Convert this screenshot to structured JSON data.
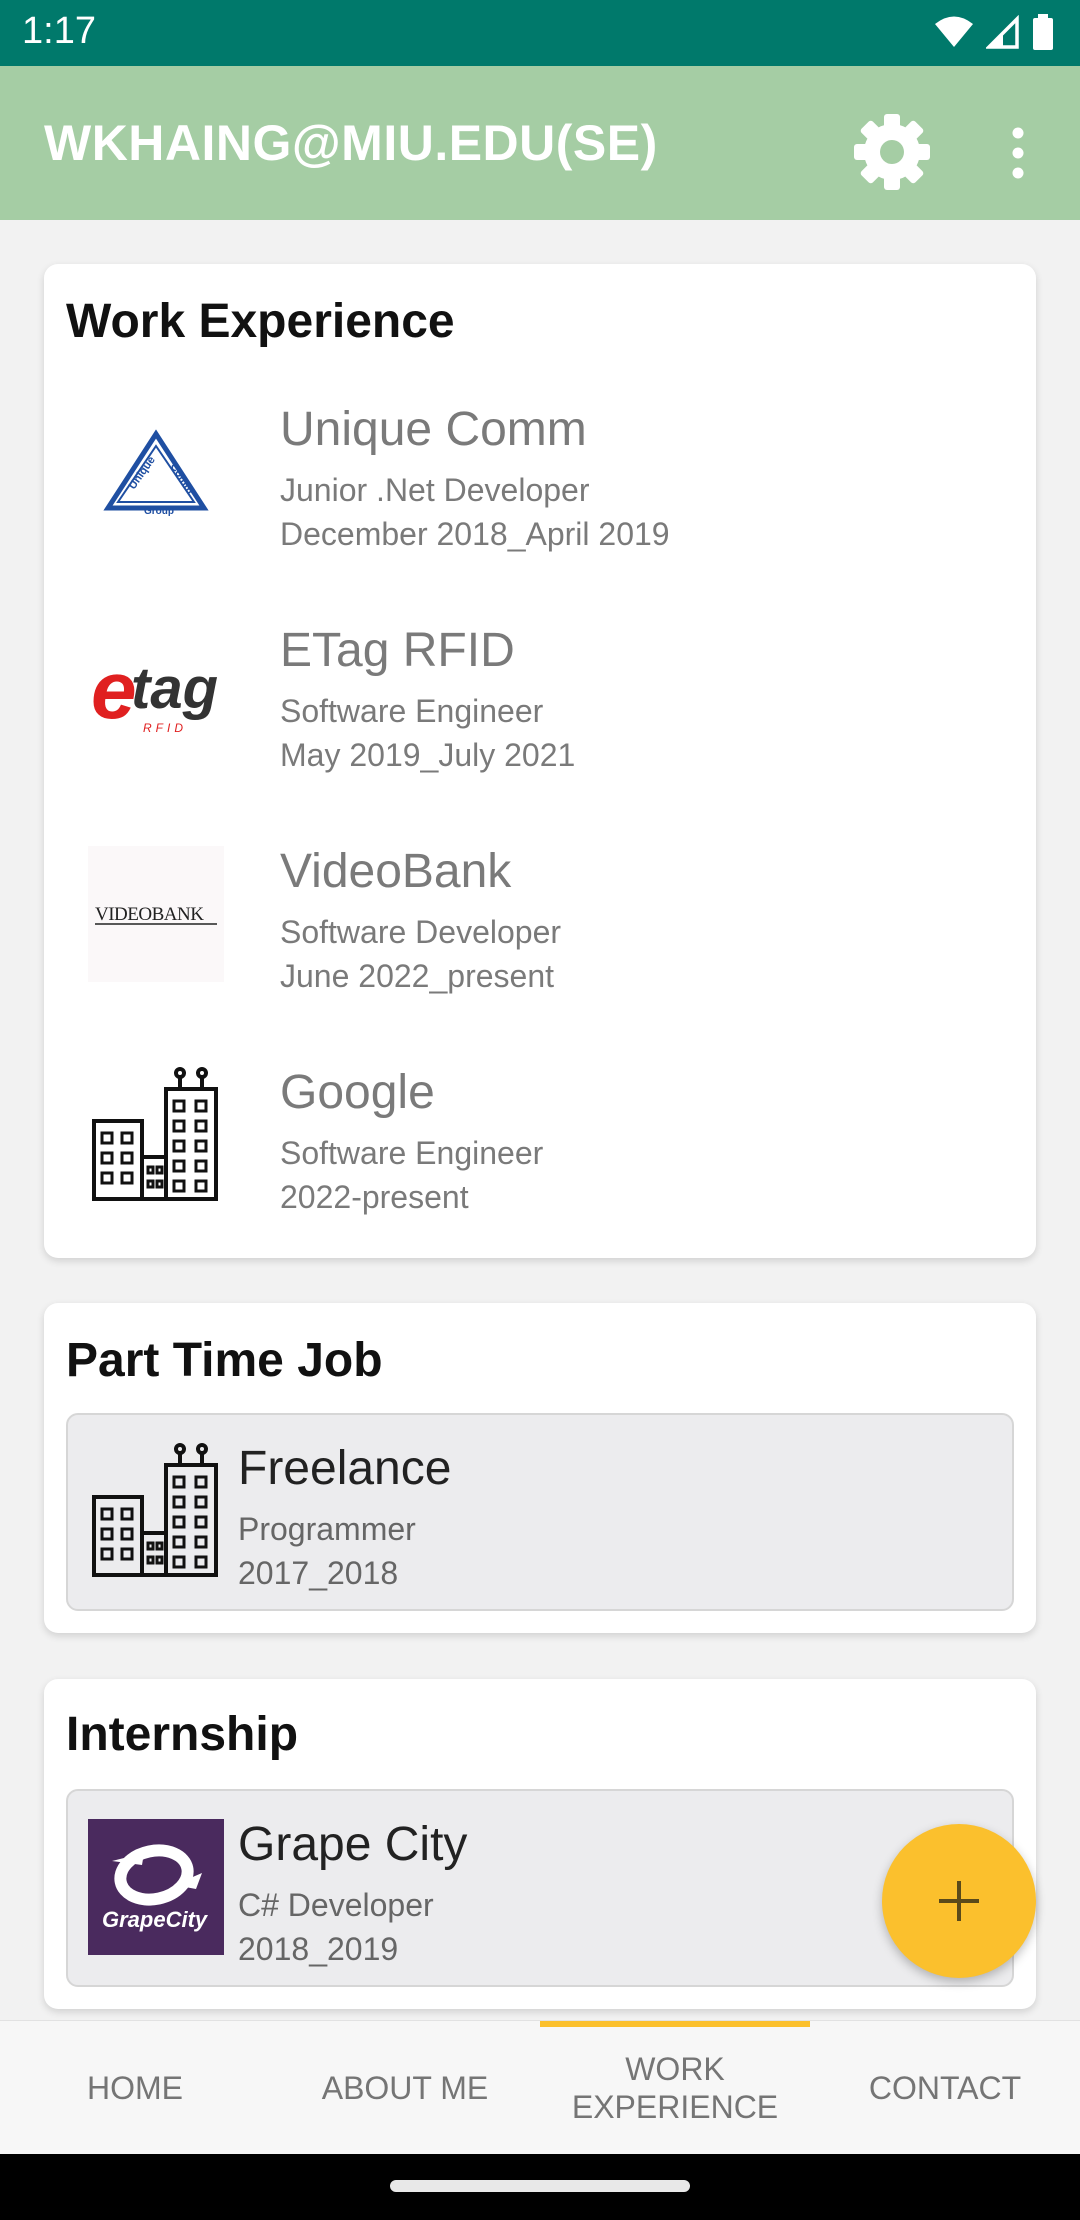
{
  "status_bar": {
    "time": "1:17"
  },
  "app_bar": {
    "title": "WKHAING@MIU.EDU(SE)"
  },
  "work_experience": {
    "title": "Work Experience",
    "items": [
      {
        "company": "Unique Comm",
        "role": "Junior .Net Developer",
        "period": "December 2018_April 2019",
        "logo": "unique-comm-logo",
        "logo_text": [
          "Unique",
          "Comm",
          "Group"
        ]
      },
      {
        "company": "ETag RFID",
        "role": "Software Engineer",
        "period": "May 2019_July 2021",
        "logo": "etag-logo",
        "logo_text": [
          "e",
          "tag",
          "RFID"
        ]
      },
      {
        "company": "VideoBank",
        "role": "Software Developer",
        "period": "June 2022_present",
        "logo": "videobank-logo",
        "logo_text": "VIDEOBANK"
      },
      {
        "company": "Google",
        "role": "Software Engineer",
        "period": "2022-present",
        "logo": "building-icon"
      }
    ]
  },
  "part_time": {
    "title": "Part Time Job",
    "items": [
      {
        "company": "Freelance",
        "role": "Programmer",
        "period": "2017_2018",
        "logo": "building-icon"
      }
    ]
  },
  "internship": {
    "title": "Internship",
    "items": [
      {
        "company": "Grape City",
        "role": "C# Developer",
        "period": "2018_2019",
        "logo": "grapecity-logo",
        "logo_text": "GrapeCity"
      }
    ]
  },
  "bottom_nav": {
    "tabs": [
      {
        "label": "HOME"
      },
      {
        "label": "ABOUT ME"
      },
      {
        "label": "WORK EXPERIENCE",
        "line1": "WORK",
        "line2": "EXPERIENCE",
        "active": true
      },
      {
        "label": "CONTACT"
      }
    ]
  },
  "colors": {
    "status_bar": "#00796b",
    "app_bar": "#a5cda4",
    "accent": "#fbc02d"
  },
  "icons": {
    "settings": "gear-icon",
    "more": "more-vert-icon",
    "fab": "add-icon",
    "wifi": "wifi-icon",
    "signal": "signal-icon",
    "battery": "battery-icon"
  }
}
